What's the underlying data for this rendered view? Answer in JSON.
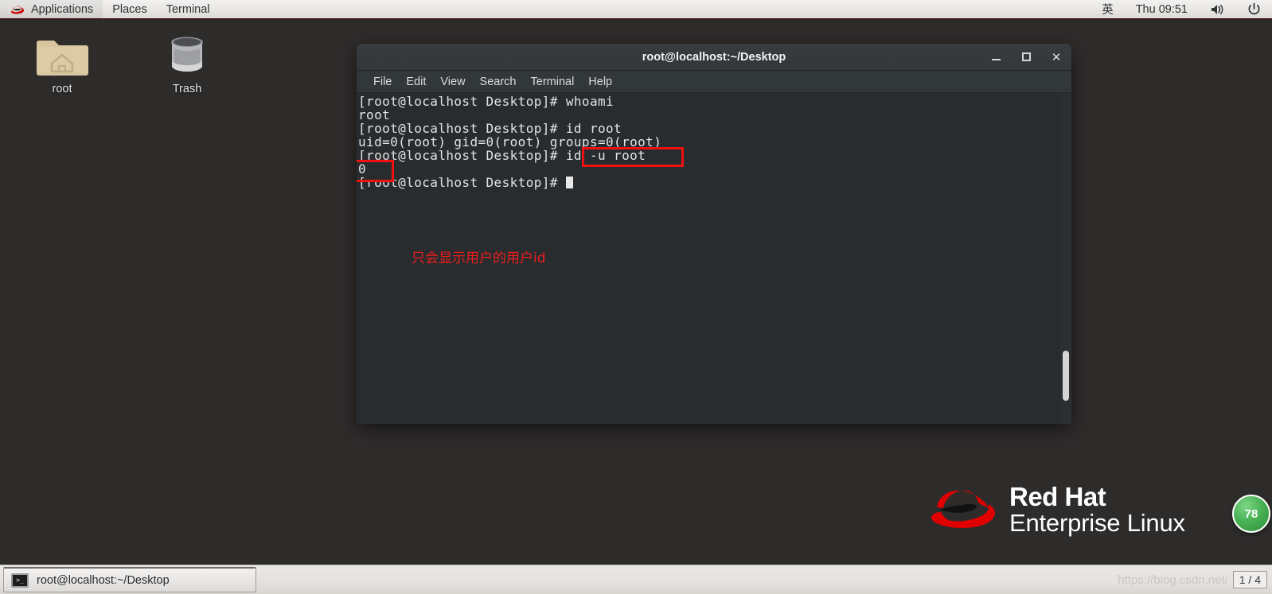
{
  "top_panel": {
    "logo_icon": "redhat-logo-icon",
    "items": [
      "Applications",
      "Places",
      "Terminal"
    ],
    "input_method": "英",
    "clock": "Thu 09:51",
    "volume_icon": "volume-icon",
    "power_icon": "power-icon"
  },
  "desktop": {
    "icons": [
      {
        "label": "root",
        "icon": "home-folder-icon"
      },
      {
        "label": "Trash",
        "icon": "trash-icon"
      }
    ],
    "annotation": "只会显示用户的用户id",
    "brand": {
      "line1": "Red Hat",
      "line2": "Enterprise Linux",
      "hat_icon": "redhat-hat-icon"
    },
    "badge": "78"
  },
  "terminal": {
    "title": "root@localhost:~/Desktop",
    "menu": [
      "File",
      "Edit",
      "View",
      "Search",
      "Terminal",
      "Help"
    ],
    "window_controls": {
      "minimize": "minimize-icon",
      "maximize": "maximize-icon",
      "close": "✕"
    },
    "content": "[root@localhost Desktop]# whoami\nroot\n[root@localhost Desktop]# id root\nuid=0(root) gid=0(root) groups=0(root)\n[root@localhost Desktop]# id -u root\n0\n[root@localhost Desktop]# "
  },
  "bottom_panel": {
    "task_label": "root@localhost:~/Desktop",
    "task_icon": "terminal-icon",
    "watermark": "https://blog.csdn.net/",
    "workspace": "1 / 4"
  },
  "colors": {
    "accent_red": "#ee1111",
    "desktop_bg": "#2e2c2b",
    "terminal_bg": "#282c2e",
    "badge_green": "#49b356"
  }
}
